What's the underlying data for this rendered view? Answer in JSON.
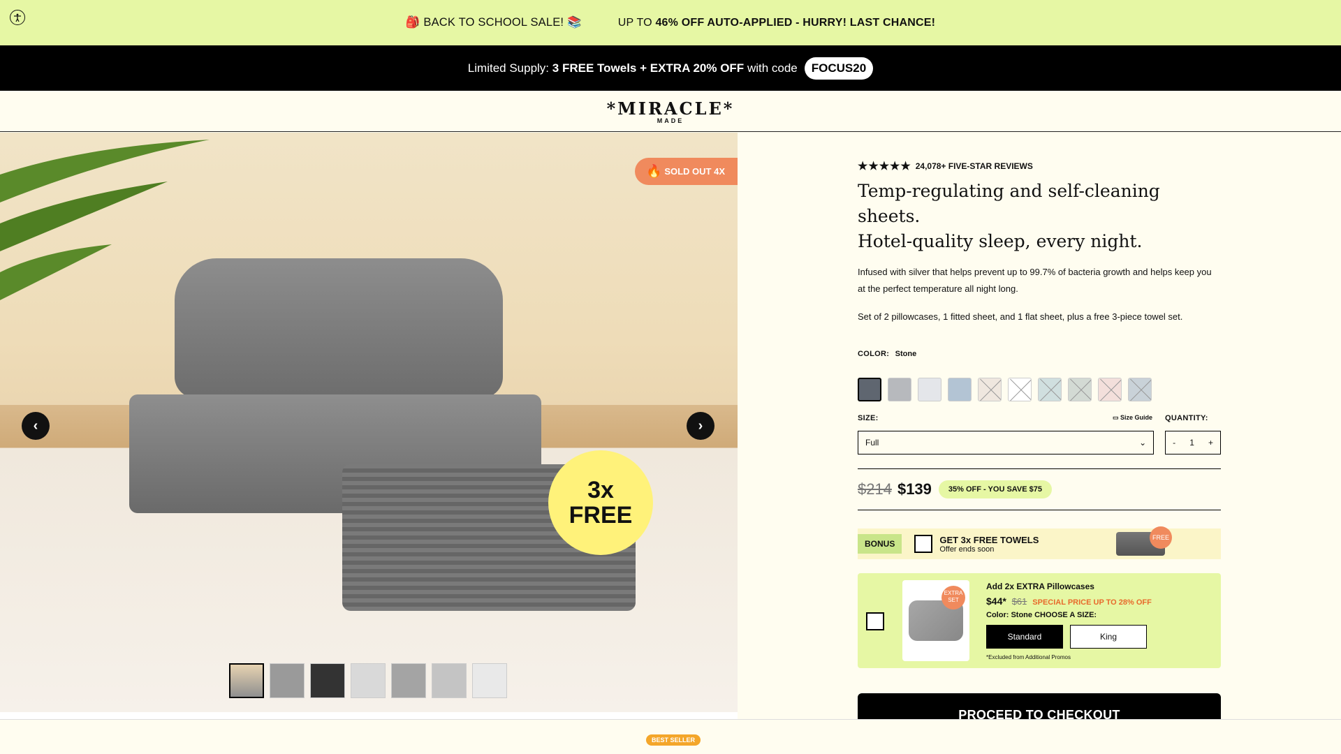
{
  "announcement": {
    "sale_text": "🎒 BACK TO SCHOOL SALE! 📚",
    "discount_prefix": "UP TO",
    "discount_text": "46% OFF AUTO-APPLIED - HURRY! LAST CHANCE!"
  },
  "promo": {
    "prefix": "Limited Supply:",
    "offer": "3 FREE Towels + EXTRA 20% OFF",
    "suffix": "with code",
    "code": "FOCUS20"
  },
  "header": {
    "logo": "*MIRACLE*",
    "logo_sub": "MADE"
  },
  "gallery": {
    "soldout": "SOLD OUT 4X",
    "badge_line1": "3x",
    "badge_line2": "FREE",
    "thumbnails": [
      {
        "name": "thumb-1"
      },
      {
        "name": "thumb-2"
      },
      {
        "name": "thumb-3"
      },
      {
        "name": "thumb-4"
      },
      {
        "name": "thumb-5"
      },
      {
        "name": "thumb-6"
      },
      {
        "name": "thumb-7"
      }
    ]
  },
  "product": {
    "reviews": "24,078+ FIVE-STAR REVIEWS",
    "title_line1": "Temp-regulating and self-cleaning sheets.",
    "title_line2": "Hotel-quality sleep, every night.",
    "description": "Infused with silver that helps prevent up to 99.7% of bacteria growth and helps keep you at the perfect temperature all night long.",
    "set_info": "Set of 2 pillowcases, 1 fitted sheet, and 1 flat sheet, plus a free 3-piece towel set.",
    "color_label": "COLOR:",
    "color_value": "Stone",
    "swatches": [
      "#5f6670",
      "#b7b9bd",
      "#e4e6ea",
      "#b3c4d4",
      "#efe7df",
      "#ffffff",
      "#d0dfdf",
      "#d3dad4",
      "#f3dfdb",
      "#c9d2d8"
    ],
    "size_label": "SIZE:",
    "size_guide": "Size Guide",
    "quantity_label": "QUANTITY:",
    "size_value": "Full",
    "qty_minus": "-",
    "qty_value": "1",
    "qty_plus": "+",
    "old_price": "$214",
    "new_price": "$139",
    "save_text": "35% OFF - YOU SAVE $75"
  },
  "bonus": {
    "tag": "BONUS",
    "title": "GET 3x FREE TOWELS",
    "sub": "Offer ends soon",
    "free": "FREE"
  },
  "addon": {
    "badge": "EXTRA SET",
    "title": "Add 2x EXTRA Pillowcases",
    "price": "$44*",
    "old_price": "$61",
    "special": "SPECIAL PRICE UP TO 28% OFF",
    "color_meta": "Color: Stone",
    "choose": "CHOOSE A SIZE:",
    "size_standard": "Standard",
    "size_king": "King",
    "note": "*Excluded from Additional Promos"
  },
  "checkout": {
    "label": "PROCEED TO CHECKOUT"
  },
  "press": {
    "bestseller": "BEST SELLER"
  }
}
